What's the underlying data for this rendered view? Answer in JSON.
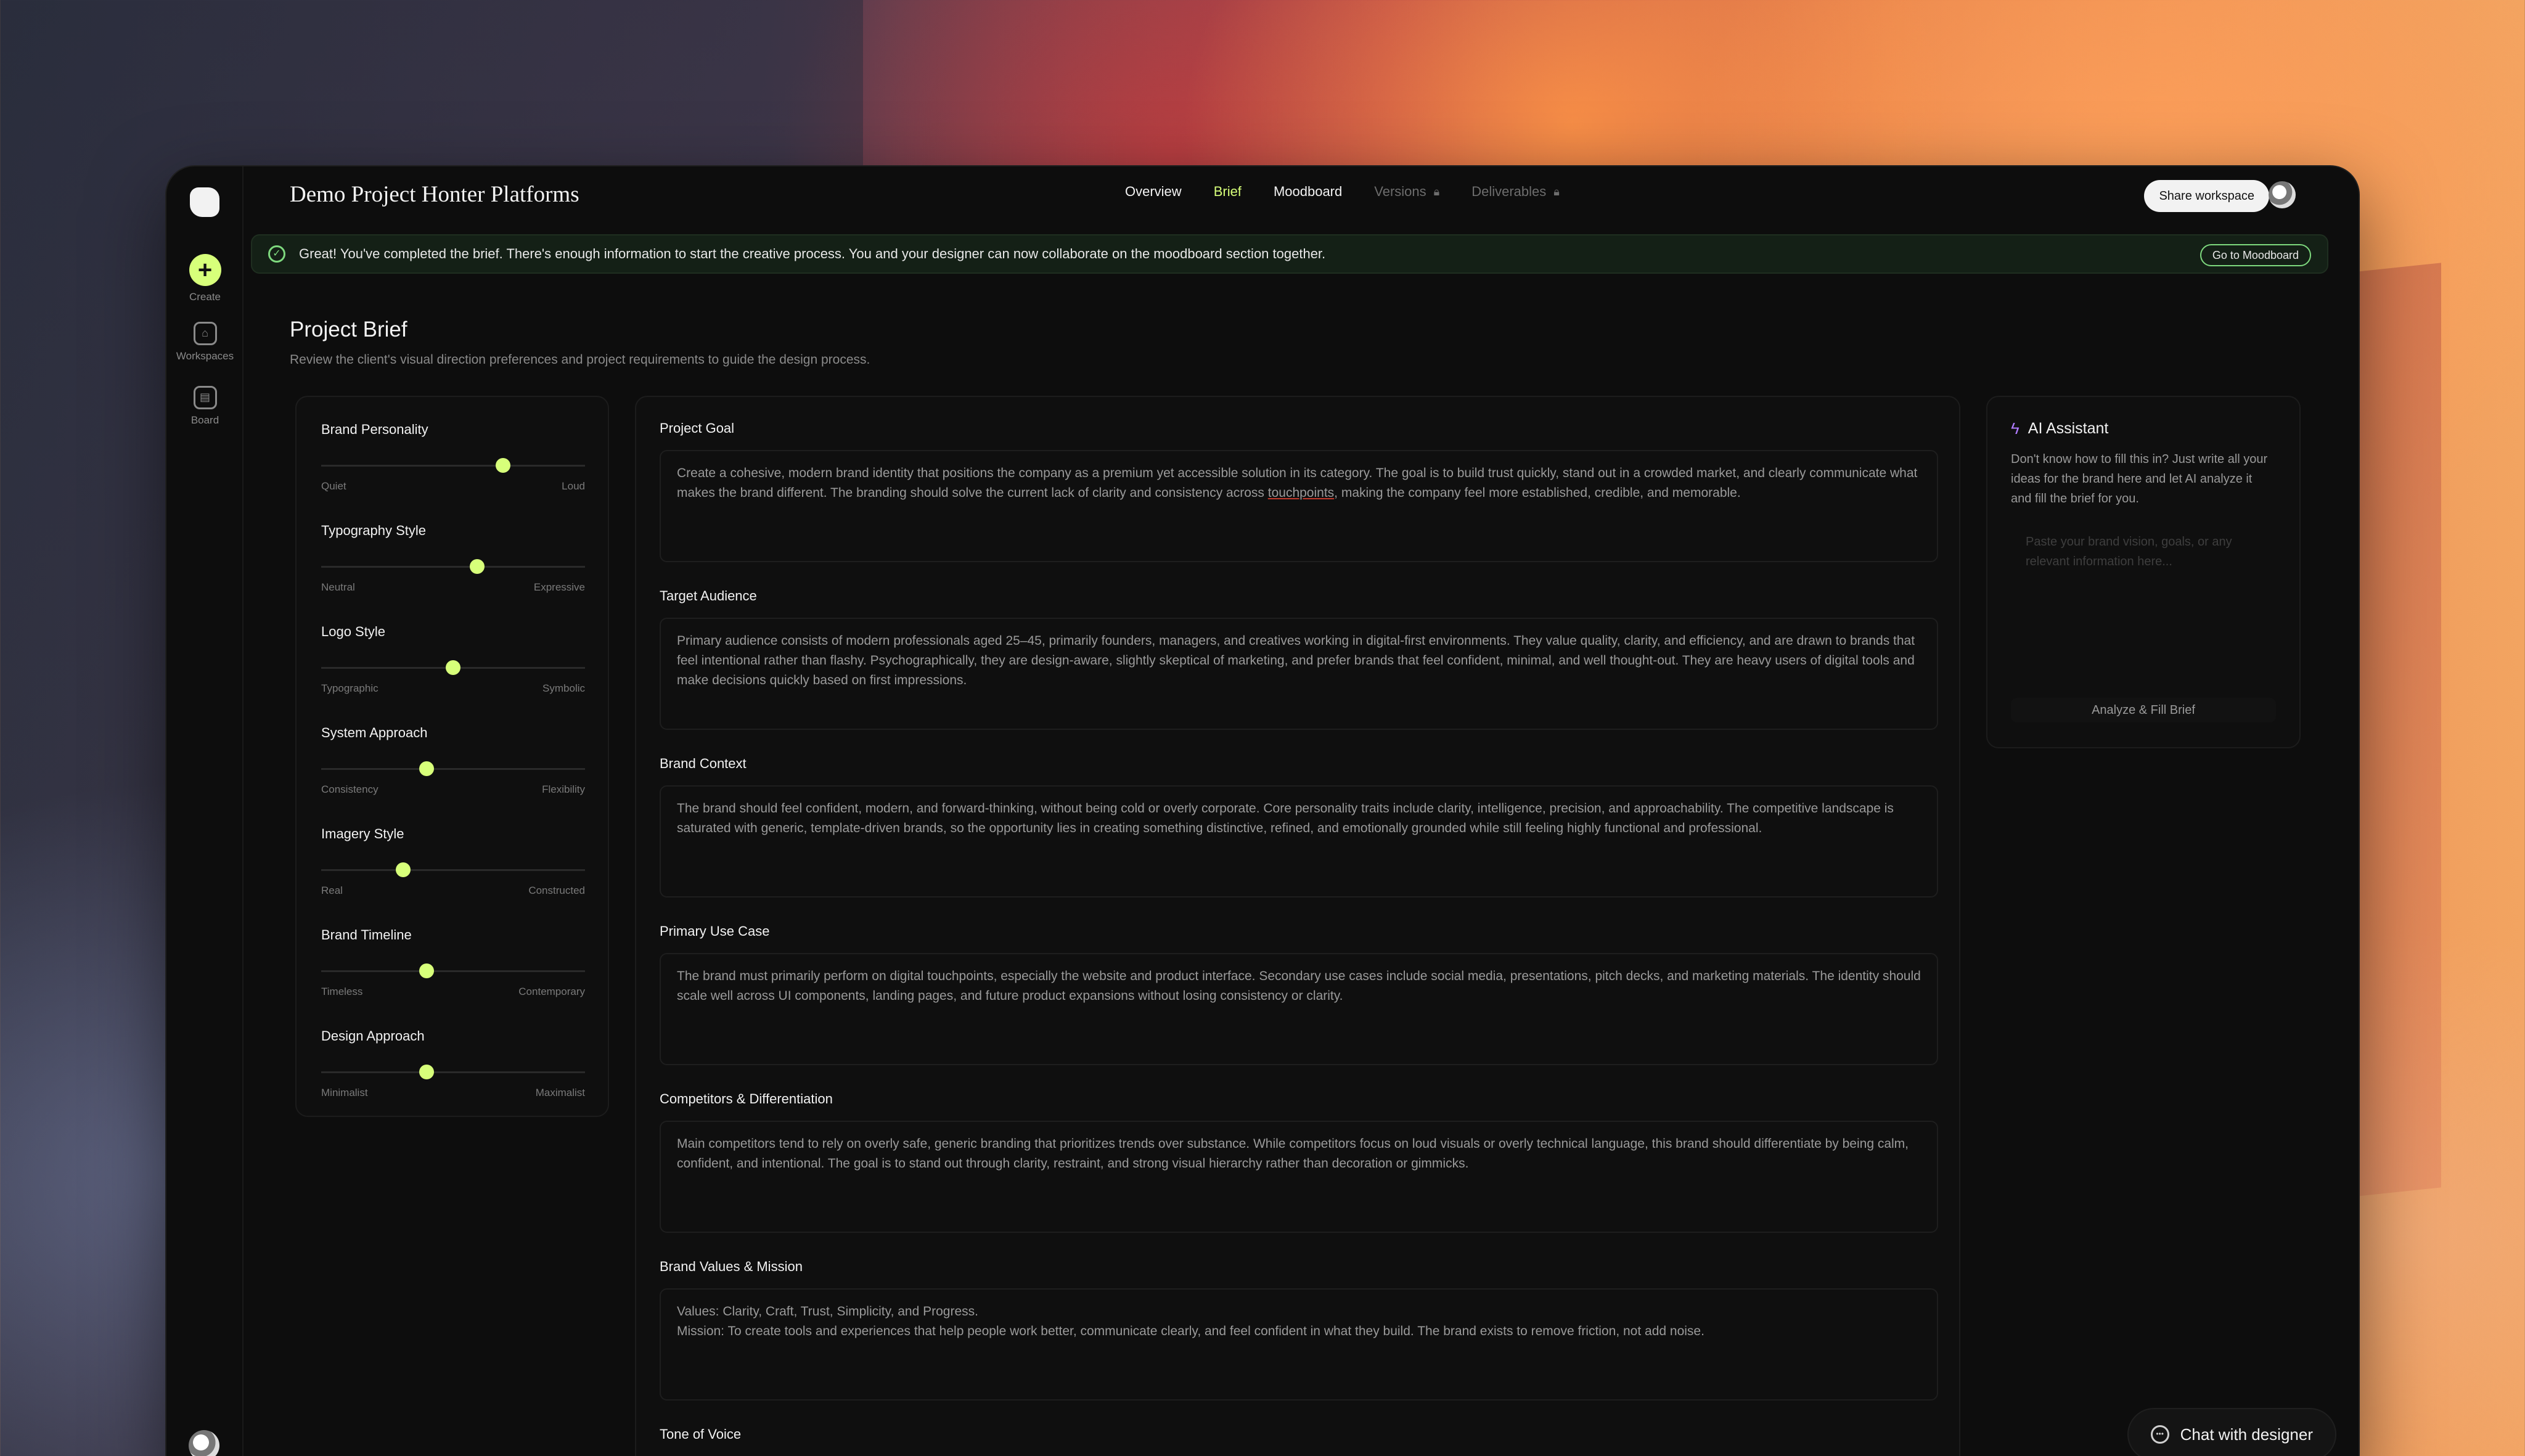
{
  "app": {
    "project_title": "Demo Project Honter Platforms",
    "rail": {
      "create": "Create",
      "workspaces": "Workspaces",
      "board": "Board"
    }
  },
  "tabs": [
    {
      "label": "Overview",
      "state": "normal"
    },
    {
      "label": "Brief",
      "state": "active"
    },
    {
      "label": "Moodboard",
      "state": "normal"
    },
    {
      "label": "Versions",
      "state": "locked"
    },
    {
      "label": "Deliverables",
      "state": "locked"
    }
  ],
  "header": {
    "share_label": "Share workspace"
  },
  "banner": {
    "text": "Great! You've completed the brief. There's enough information to start the creative process. You and your designer can now collaborate on the moodboard section together.",
    "button": "Go to Moodboard"
  },
  "page": {
    "title": "Project Brief",
    "subtitle": "Review the client's visual direction preferences and project requirements to guide the design process."
  },
  "sliders": [
    {
      "name": "Brand Personality",
      "left": "Quiet",
      "right": "Loud",
      "value": 0.69
    },
    {
      "name": "Typography Style",
      "left": "Neutral",
      "right": "Expressive",
      "value": 0.59
    },
    {
      "name": "Logo Style",
      "left": "Typographic",
      "right": "Symbolic",
      "value": 0.5
    },
    {
      "name": "System Approach",
      "left": "Consistency",
      "right": "Flexibility",
      "value": 0.4
    },
    {
      "name": "Imagery Style",
      "left": "Real",
      "right": "Constructed",
      "value": 0.31
    },
    {
      "name": "Brand Timeline",
      "left": "Timeless",
      "right": "Contemporary",
      "value": 0.4
    },
    {
      "name": "Design Approach",
      "left": "Minimalist",
      "right": "Maximalist",
      "value": 0.4
    }
  ],
  "fields": [
    {
      "label": "Project Goal",
      "value_before": "Create a cohesive, modern brand identity that positions the company as a premium yet accessible solution in its category. The goal is to build trust quickly, stand out in a crowded market, and clearly communicate what makes the brand different. The branding should solve the current lack of clarity and consistency across ",
      "value_underlined": "touchpoints",
      "value_after": ", making the company feel more established, credible, and memorable."
    },
    {
      "label": "Target Audience",
      "value_before": "Primary audience consists of modern professionals aged 25–45, primarily founders, managers, and creatives working in digital-first environments. They value quality, clarity, and efficiency, and are drawn to brands that feel intentional rather than flashy. Psychographically, they are design-aware, slightly skeptical of marketing, and prefer brands that feel confident, minimal, and well thought-out. They are heavy users of digital tools and make decisions quickly based on first impressions.",
      "value_underlined": "",
      "value_after": ""
    },
    {
      "label": "Brand Context",
      "value_before": "The brand should feel confident, modern, and forward-thinking, without being cold or overly corporate. Core personality traits include clarity, intelligence, precision, and approachability. The competitive landscape is saturated with generic, template-driven brands, so the opportunity lies in creating something distinctive, refined, and emotionally grounded while still feeling highly functional and professional.",
      "value_underlined": "",
      "value_after": ""
    },
    {
      "label": "Primary Use Case",
      "value_before": "The brand must primarily perform on digital touchpoints, especially the website and product interface. Secondary use cases include social media, presentations, pitch decks, and marketing materials. The identity should scale well across UI components, landing pages, and future product expansions without losing consistency or clarity.",
      "value_underlined": "",
      "value_after": ""
    },
    {
      "label": "Competitors & Differentiation",
      "value_before": "Main competitors tend to rely on overly safe, generic branding that prioritizes trends over substance. While competitors focus on loud visuals or overly technical language, this brand should differentiate by being calm, confident, and intentional. The goal is to stand out through clarity, restraint, and strong visual hierarchy rather than decoration or gimmicks.",
      "value_underlined": "",
      "value_after": ""
    },
    {
      "label": "Brand Values & Mission",
      "value_before": "Values: Clarity, Craft, Trust, Simplicity, and Progress.",
      "value_underlined": "",
      "value_after": "Mission: To create tools and experiences that help people work better, communicate clearly, and feel confident in what they build. The brand exists to remove friction, not add noise."
    },
    {
      "label": "Tone of Voice",
      "value_before": "",
      "value_underlined": "",
      "value_after": ""
    }
  ],
  "ai": {
    "title": "AI Assistant",
    "description": "Don't know how to fill this in? Just write all your ideas for the brand here and let AI analyze it and fill the brief for you.",
    "placeholder": "Paste your brand vision, goals, or any relevant information here...",
    "button": "Analyze & Fill Brief"
  },
  "chat": {
    "label": "Chat with designer"
  },
  "colors": {
    "accent": "#d7ff7a",
    "success": "#7ed97e",
    "ai_accent": "#b07cff"
  }
}
